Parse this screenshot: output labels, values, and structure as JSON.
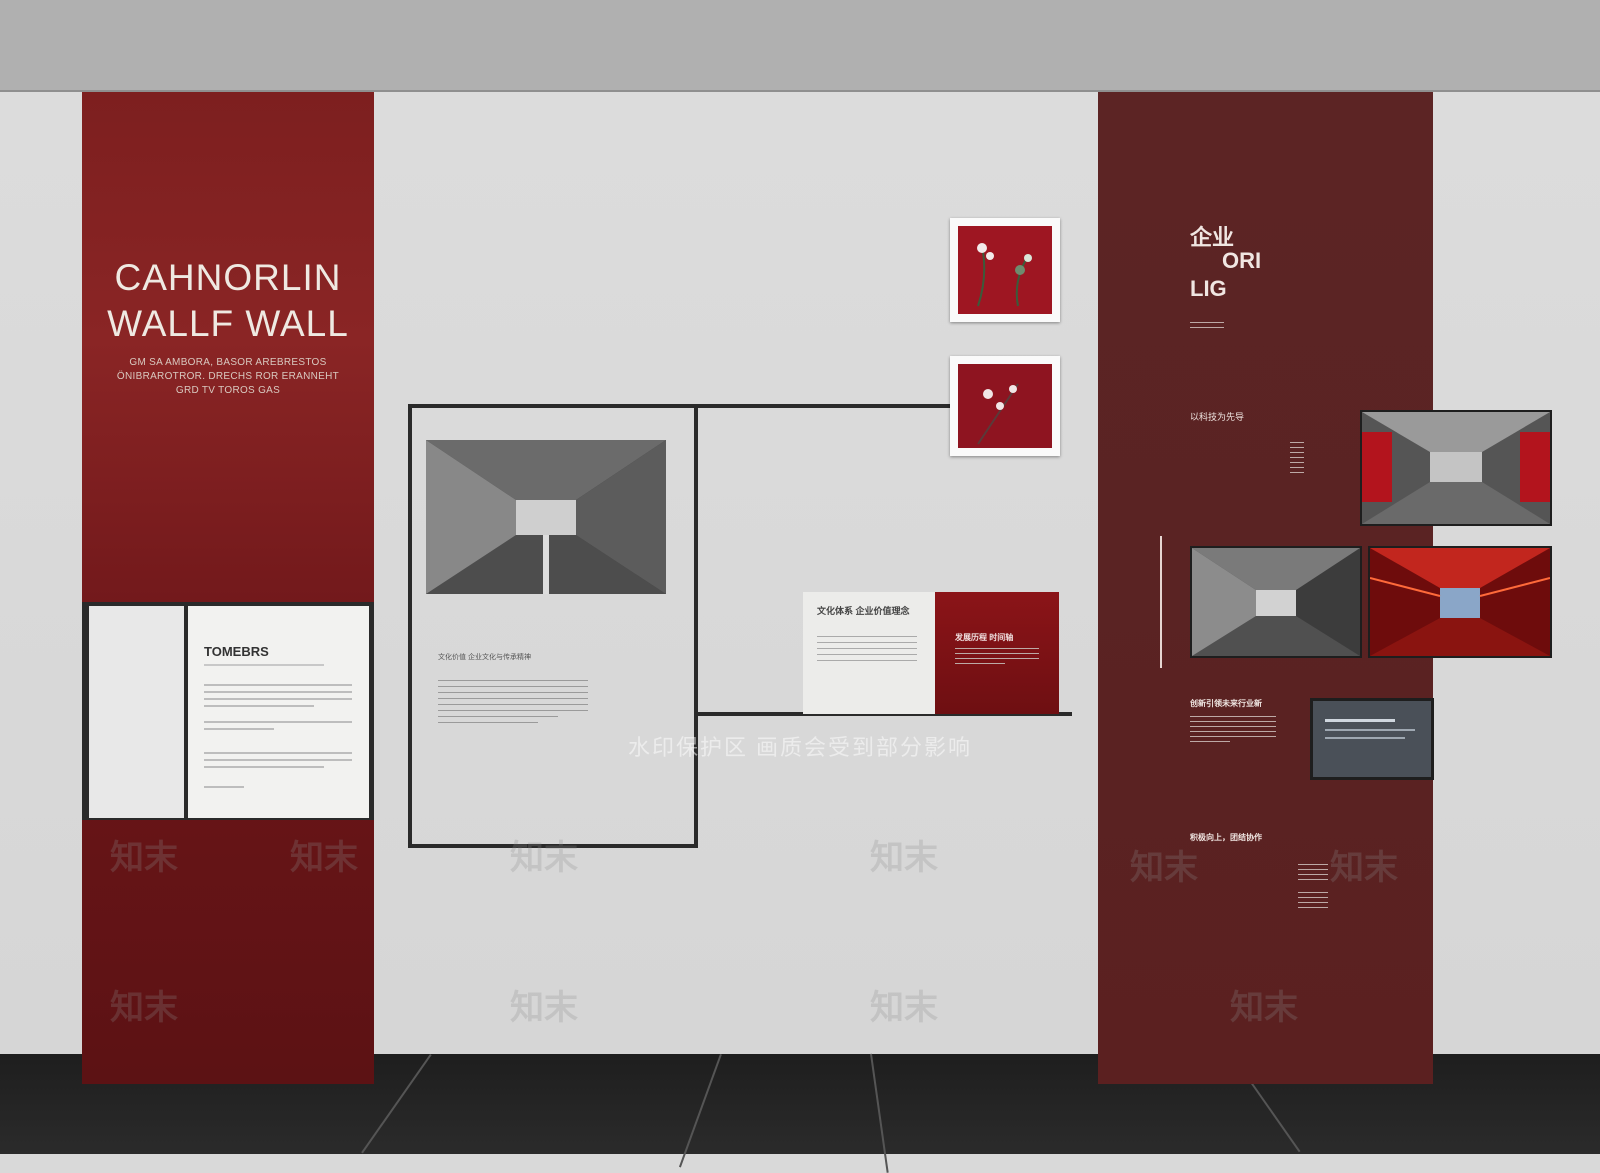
{
  "left_panel": {
    "title_line1": "CAHNORLIN",
    "title_line2": "WALLF WALL",
    "subtitle_lines": [
      "GM SA AMBORA, BASOR AREBRESTOS",
      "ÖNIBRAROTROR. DRECHS ROR ERANNEHT",
      "GRD TV TOROS GAS"
    ],
    "card_title": "TOMEBRS"
  },
  "center": {
    "main_text_line1": "文化价值 企业文化与传承精神"
  },
  "small_cards": {
    "left_title": "文化体系 企业价值理念",
    "right_title": "发展历程 时间轴"
  },
  "right_panel": {
    "title_line1": "企业",
    "title_line2": "ORI",
    "title_line3": "LIG",
    "intro_line1": "以科技为先导",
    "section1": "以科技为先导",
    "section2": "创新引领未来行业新",
    "section3": "积极向上，团结协作"
  },
  "watermark": {
    "band_text": "水印保护区   画质会受到部分影响",
    "brand": "知末"
  },
  "colors": {
    "left_panel_red": "#7d1f1f",
    "right_panel_maroon": "#5a2323",
    "wall_grey": "#d9d9d9",
    "ceiling_grey": "#b0b0b0",
    "floor_dark": "#1e1e1e"
  }
}
